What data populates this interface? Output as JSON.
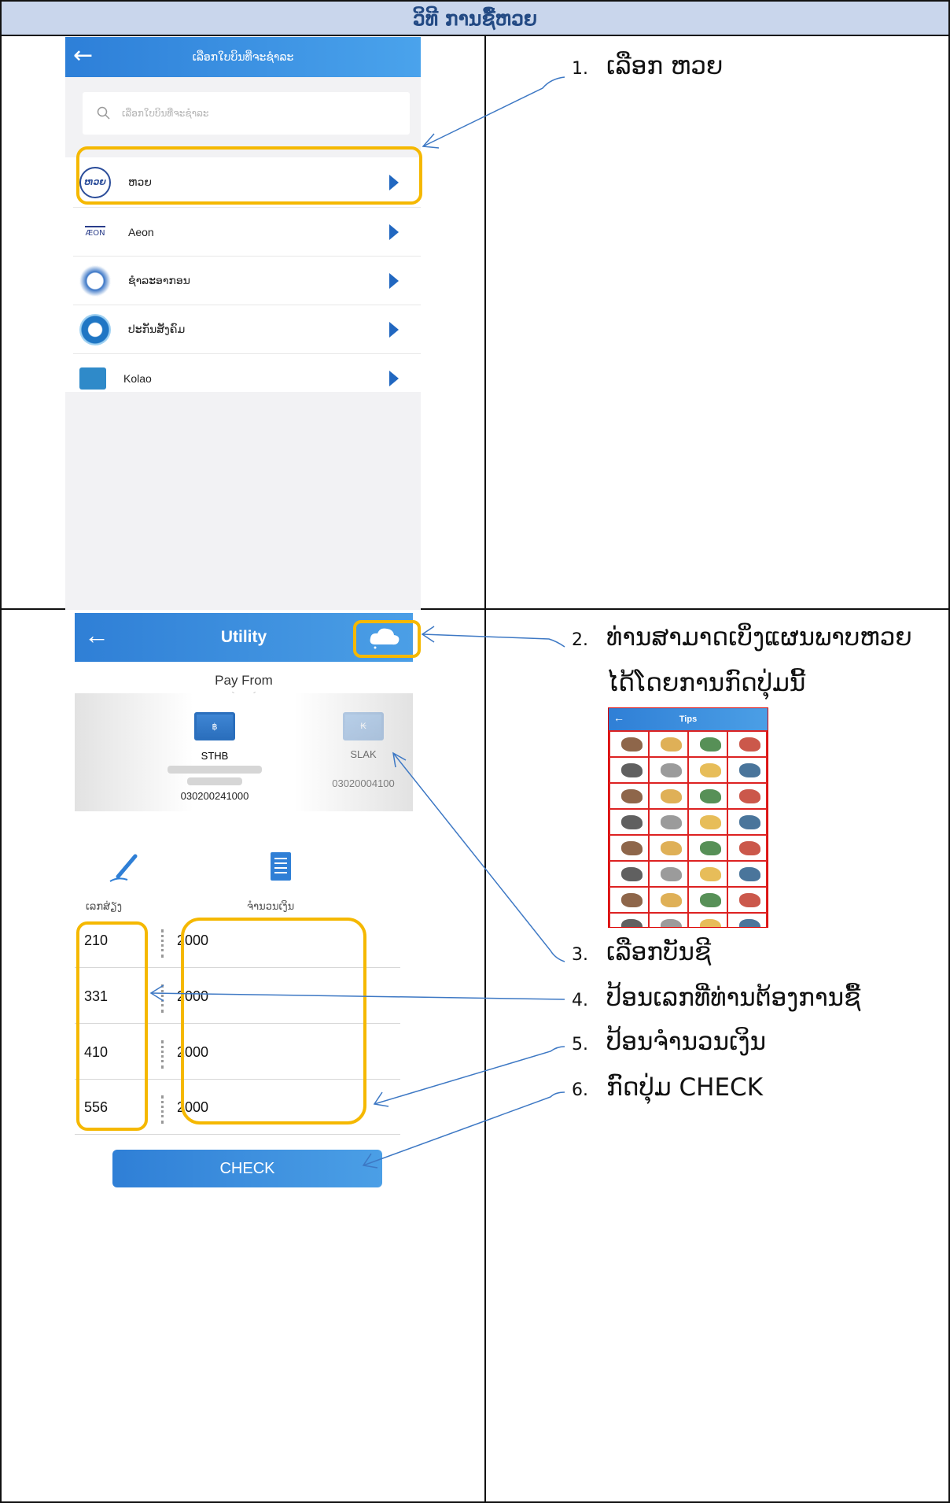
{
  "title": "ວິທີ ການຊື້ຫວຍ",
  "screen1": {
    "header_title": "ເລືອກໃບບິນທີ່ຈະຊໍາລະ",
    "search_placeholder": "ເລືອກໃບບິນທີ່ຈະຊໍາລະ",
    "items": [
      {
        "label": "ຫວຍ",
        "logo": "lottery-logo"
      },
      {
        "label": "Aeon",
        "logo": "aeon-logo"
      },
      {
        "label": "ຊໍາລະອາກອນ",
        "logo": "tax-logo"
      },
      {
        "label": "ປະກັນສັງຄົມ",
        "logo": "social-security-logo"
      },
      {
        "label": "Kolao",
        "logo": "kolao-logo"
      }
    ],
    "lottery_logo_text": "ຫວຍ",
    "aeon_logo_text": "ÆON"
  },
  "screen2": {
    "header_title": "Utility",
    "pay_from": "Pay From",
    "accounts": [
      {
        "currency_symbol": "฿",
        "name": "STHB",
        "number": "030200241000"
      },
      {
        "currency_symbol": "₭",
        "name": "SLAK",
        "number": "03020004100"
      }
    ],
    "col_number": "ເລກສ່ຽງ",
    "col_amount": "ຈຳນວນເງິນ",
    "rows": [
      {
        "number": "210",
        "amount": "2000"
      },
      {
        "number": "331",
        "amount": "2000"
      },
      {
        "number": "410",
        "amount": "2000"
      },
      {
        "number": "556",
        "amount": "2000"
      }
    ],
    "check_label": "CHECK"
  },
  "steps": [
    {
      "num": "1.",
      "text": "ເລືອກ ຫວຍ"
    },
    {
      "num": "2.",
      "text": "ທ່ານສາມາດເບິ່ງແຜນພາບຫວຍ",
      "text2": "ໄດ້ໂດຍການກົດປຸ່ມນີ້"
    },
    {
      "num": "3.",
      "text": "ເລືອກບັນຊີ"
    },
    {
      "num": "4.",
      "text": "ປ້ອນເລກທີ່ທ່ານຕ້ອງການຊື້"
    },
    {
      "num": "5.",
      "text": "ປ້ອນຈຳນວນເງິນ"
    },
    {
      "num": "6.",
      "text": "ກົດປຸ່ມ CHECK"
    }
  ],
  "tips": {
    "title": "Tips"
  },
  "colors": {
    "accent": "#2f7fd6",
    "highlight": "#f5b800",
    "title_bg": "#c9d6ec",
    "title_text": "#234a84",
    "arrow": "#3d78c4"
  }
}
